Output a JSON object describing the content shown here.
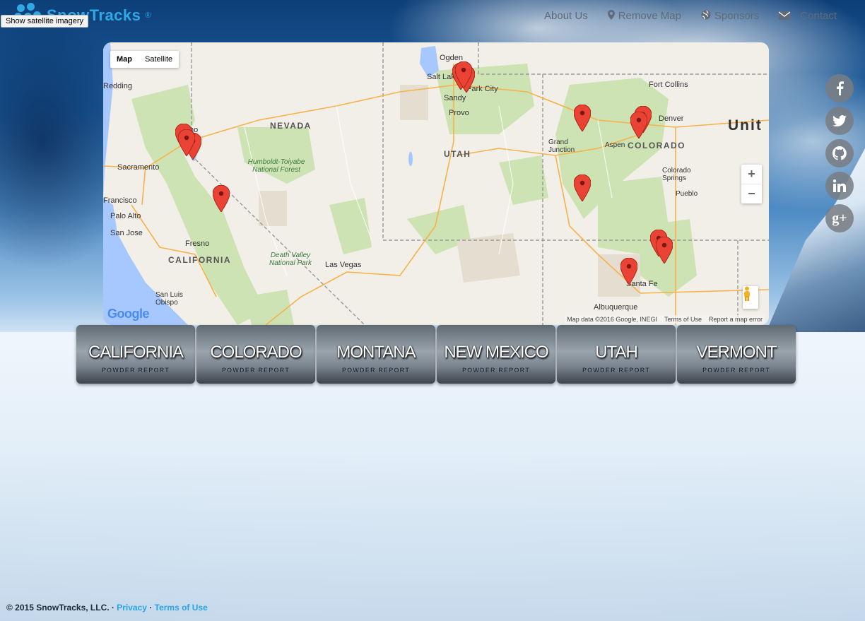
{
  "header": {
    "logo_text": "SnowTracks",
    "logo_mark": "®",
    "tooltip": "Show satellite imagery",
    "nav": [
      {
        "label": "About Us",
        "icon": ""
      },
      {
        "label": "Remove Map",
        "icon": "map-marker-icon"
      },
      {
        "label": "Sponsors",
        "icon": "globe-icon"
      },
      {
        "label": "Contact",
        "icon": "envelope-icon"
      }
    ]
  },
  "map": {
    "type_buttons": [
      "Map",
      "Satellite"
    ],
    "zoom_in": "+",
    "zoom_out": "−",
    "logo": "Google",
    "attribution": [
      "Map data ©2016 Google, INEGI",
      "Terms of Use",
      "Report a map error"
    ],
    "state_labels": [
      "NEVADA",
      "UTAH",
      "COLORADO",
      "CALIFORNIA"
    ],
    "country_label": "Unit",
    "park_labels": [
      "Humboldt-Toiyabe National Forest",
      "Death Valley National Park"
    ],
    "city_labels": [
      "Ogden",
      "Salt Lake City",
      "Park City",
      "Sandy",
      "Provo",
      "Fort Collins",
      "Denver",
      "Redding",
      "Reno",
      "Sacramento",
      "Francisco",
      "Palo Alto",
      "San Jose",
      "Fresno",
      "Las Vegas",
      "Grand Junction",
      "Aspen",
      "Colorado Springs",
      "Pueblo",
      "Santa Fe",
      "Albuquerque",
      "San Luis Obispo"
    ],
    "marker_count": 14
  },
  "states": [
    {
      "name": "CALIFORNIA",
      "sub": "POWDER REPORT"
    },
    {
      "name": "COLORADO",
      "sub": "POWDER REPORT"
    },
    {
      "name": "MONTANA",
      "sub": "POWDER REPORT"
    },
    {
      "name": "NEW MEXICO",
      "sub": "POWDER REPORT"
    },
    {
      "name": "UTAH",
      "sub": "POWDER REPORT"
    },
    {
      "name": "VERMONT",
      "sub": "POWDER REPORT"
    }
  ],
  "social": [
    "facebook-icon",
    "twitter-icon",
    "github-icon",
    "linkedin-icon",
    "google-plus-icon"
  ],
  "footer": {
    "copyright": "© 2015 SnowTracks, LLC. ·",
    "privacy": "Privacy",
    "dot": "·",
    "terms": "Terms of Use"
  }
}
